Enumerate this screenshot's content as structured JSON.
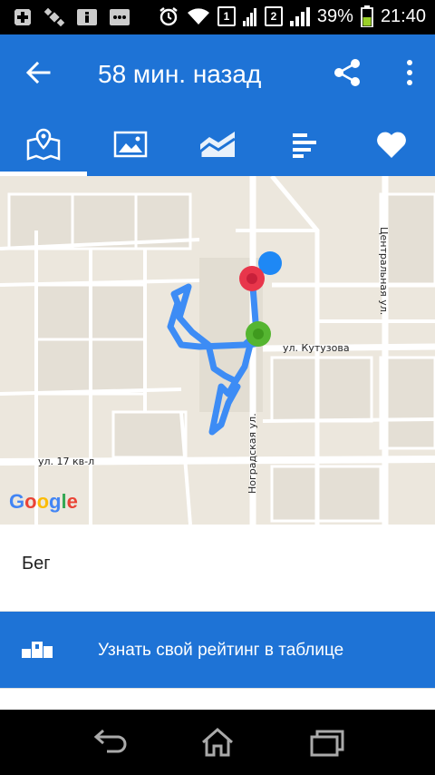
{
  "status_bar": {
    "sim1": "1",
    "sim2": "2",
    "battery": "39%",
    "time": "21:40",
    "icons": [
      "add-box-icon",
      "satellite-icon",
      "info-icon",
      "message-icon",
      "alarm-icon",
      "wifi-icon",
      "signal-icon",
      "signal-icon",
      "battery-icon"
    ]
  },
  "app_bar": {
    "title": "58 мин. назад",
    "back_icon": "arrow-back-icon",
    "share_icon": "share-icon",
    "more_icon": "more-vert-icon"
  },
  "tabs": [
    {
      "icon": "map-pin-icon",
      "active": true
    },
    {
      "icon": "photo-icon",
      "active": false
    },
    {
      "icon": "trend-chart-icon",
      "active": false
    },
    {
      "icon": "bar-list-icon",
      "active": false
    },
    {
      "icon": "heart-icon",
      "active": false
    }
  ],
  "map": {
    "streets": {
      "kutuzova": "ул. Кутузова",
      "nogradskaya": "Ноградская ул.",
      "centralnaya": "Центральная ул.",
      "kv17": "ул. 17 кв-л"
    },
    "logo": {
      "G": "G",
      "o1": "o",
      "o2": "o",
      "g": "g",
      "l": "l",
      "e": "e"
    },
    "colors": {
      "route": "#3d8cf5",
      "start_marker": "#55b531",
      "end_marker": "#e8364b",
      "location_marker": "#1e88f5"
    }
  },
  "activity": {
    "label": "Бег"
  },
  "rating": {
    "label": "Узнать свой рейтинг в таблице",
    "icon": "podium-icon"
  },
  "nav_bar": {
    "icons": [
      "back-icon",
      "home-icon",
      "recent-apps-icon"
    ]
  },
  "colors": {
    "primary": "#1e73d6",
    "status_bar": "#000000"
  }
}
